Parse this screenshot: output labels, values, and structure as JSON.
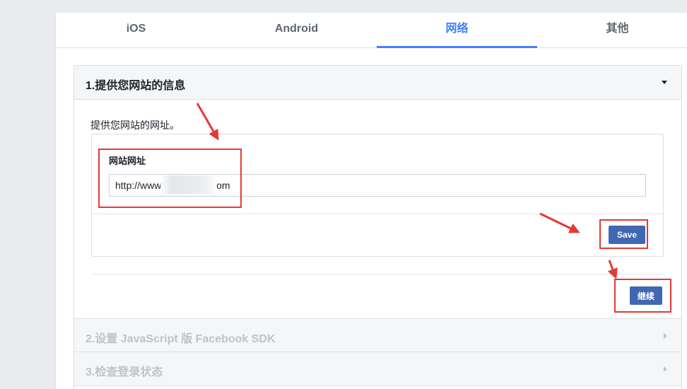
{
  "tabs": [
    {
      "label": "iOS",
      "active": false
    },
    {
      "label": "Android",
      "active": false
    },
    {
      "label": "网络",
      "active": true
    },
    {
      "label": "其他",
      "active": false
    }
  ],
  "steps": [
    {
      "title": "1.提供您网站的信息",
      "expanded": true
    },
    {
      "title": "2.设置 JavaScript 版 Facebook SDK",
      "expanded": false
    },
    {
      "title": "3.检查登录状态",
      "expanded": false
    }
  ],
  "step1": {
    "description": "提供您网站的网址。",
    "field_label": "网站网址",
    "url_value": "http://www                    om",
    "save_label": "Save",
    "continue_label": "继续"
  },
  "colors": {
    "accent": "#4080ff",
    "button": "#4267b2",
    "annotation": "#e53935"
  }
}
